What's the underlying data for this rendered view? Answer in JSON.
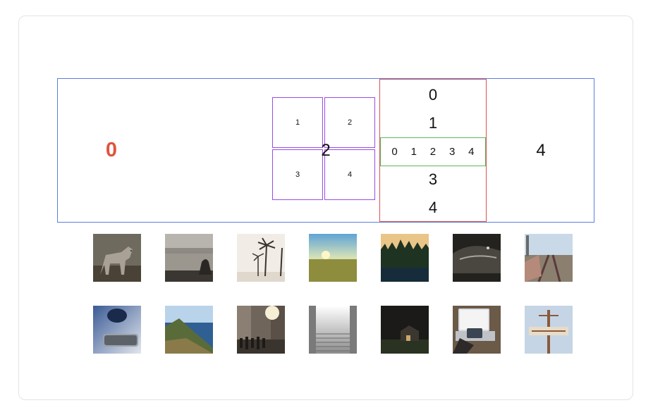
{
  "carousel": {
    "active_slide": "0",
    "grid_slide": [
      "1",
      "2",
      "3",
      "4"
    ],
    "slide_2": "2",
    "vertical_slides": [
      "0",
      "1",
      "3",
      "4"
    ],
    "horizontal_slides": [
      "0",
      "1",
      "2",
      "3",
      "4"
    ],
    "slide_4": "4"
  },
  "thumbnails": {
    "row1": [
      {
        "icon": "coyote-photo"
      },
      {
        "icon": "city-skyline-photo"
      },
      {
        "icon": "palm-trees-photo"
      },
      {
        "icon": "sunset-field-photo"
      },
      {
        "icon": "forest-photo"
      },
      {
        "icon": "car-night-photo"
      },
      {
        "icon": "railway-photo"
      }
    ],
    "row2": [
      {
        "icon": "phone-photo"
      },
      {
        "icon": "coast-photo"
      },
      {
        "icon": "street-crowd-photo"
      },
      {
        "icon": "stairs-photo"
      },
      {
        "icon": "barn-night-photo"
      },
      {
        "icon": "laptop-photo"
      },
      {
        "icon": "signpost-photo"
      }
    ]
  }
}
